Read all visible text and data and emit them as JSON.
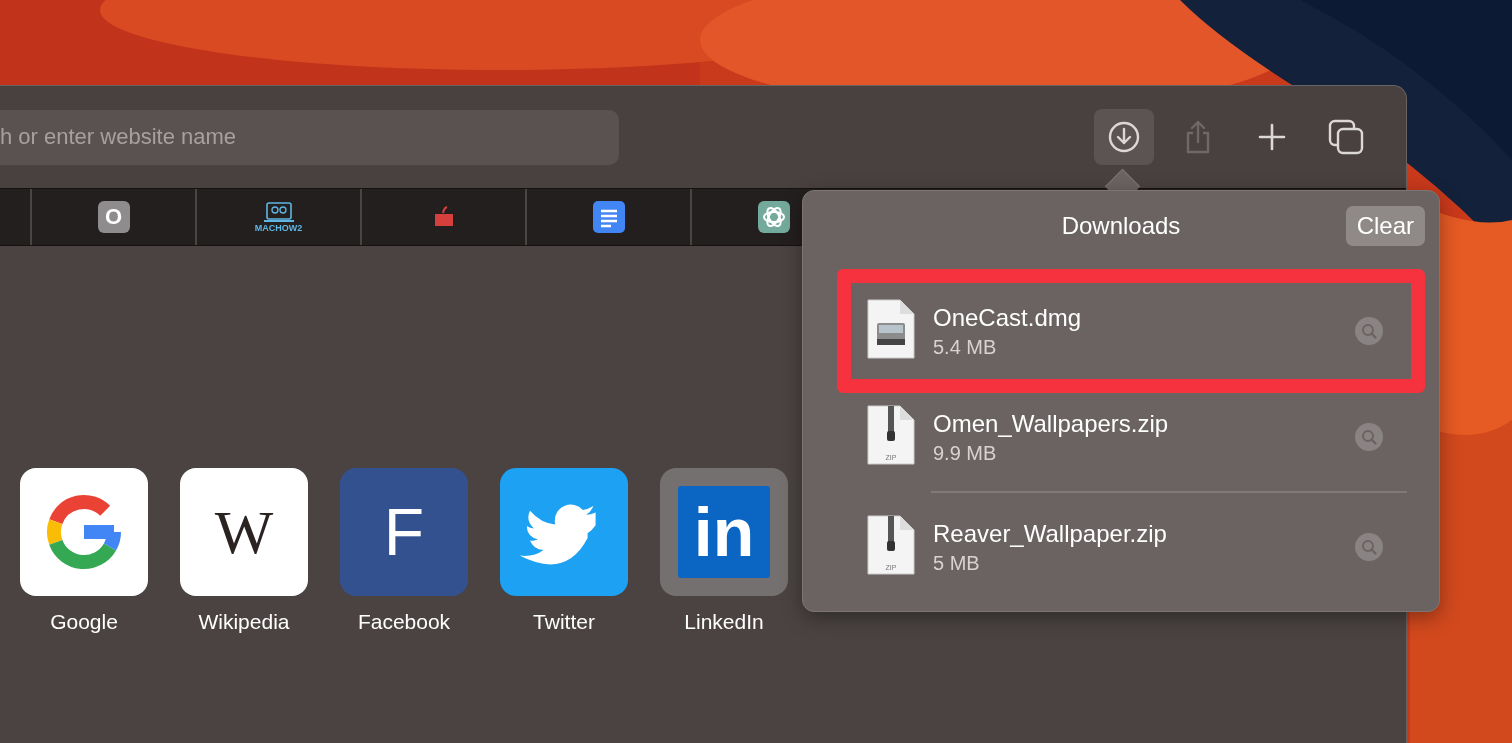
{
  "address_bar": {
    "placeholder": "h or enter website name"
  },
  "toolbar_buttons": [
    {
      "kind": "downloads",
      "selected": true,
      "disabled": false
    },
    {
      "kind": "share",
      "selected": false,
      "disabled": true
    },
    {
      "kind": "new_tab",
      "selected": false,
      "disabled": false
    },
    {
      "kind": "tab_overview",
      "selected": false,
      "disabled": false
    }
  ],
  "bookmarks_bar": [
    {
      "kind": "letter",
      "glyph": "O"
    },
    {
      "kind": "laptop",
      "caption": "MACHOW2"
    },
    {
      "kind": "apple"
    },
    {
      "kind": "doc"
    },
    {
      "kind": "knot"
    }
  ],
  "favorites": [
    {
      "label": "Google",
      "kind": "google"
    },
    {
      "label": "Wikipedia",
      "kind": "wiki",
      "glyph": "W"
    },
    {
      "label": "Facebook",
      "kind": "facebook",
      "glyph": "F"
    },
    {
      "label": "Twitter",
      "kind": "bird"
    },
    {
      "label": "LinkedIn",
      "kind": "linkedin",
      "glyph": "in"
    }
  ],
  "downloads": {
    "title": "Downloads",
    "clear_button": "Clear",
    "items": [
      {
        "name": "OneCast.dmg",
        "size": "5.4 MB",
        "kind": "disk",
        "annotated": true
      },
      {
        "name": "Omen_Wallpapers.zip",
        "size": "9.9 MB",
        "kind": "zip",
        "icon_label": "ZIP",
        "annotated": false
      },
      {
        "name": "Reaver_Wallpaper.zip",
        "size": "5 MB",
        "kind": "zip",
        "icon_label": "ZIP",
        "annotated": false
      }
    ]
  }
}
